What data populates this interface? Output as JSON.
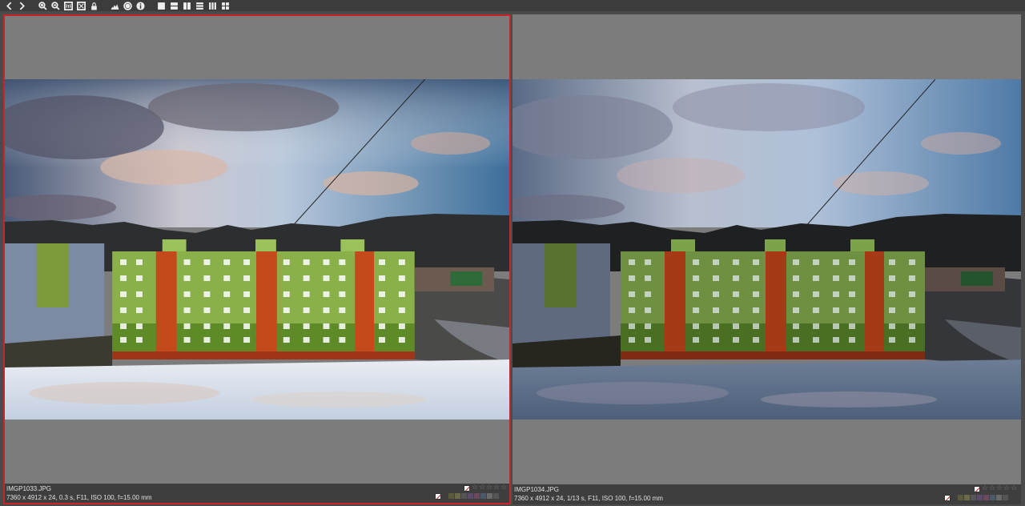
{
  "toolbar": {
    "items": [
      {
        "name": "prev-icon",
        "glyph": "‹"
      },
      {
        "name": "next-icon",
        "glyph": "›"
      }
    ]
  },
  "left_pane": {
    "filename": "IMGP1033.JPG",
    "meta": "7360 x 4912 x 24, 0.3 s, F11, ISO 100, f=15.00 mm",
    "rating_stars": 5,
    "selected": true
  },
  "right_pane": {
    "filename": "IMGP1034.JPG",
    "meta": "7360 x 4912 x 24, 1/13 s, F11, ISO 100, f=15.00 mm",
    "rating_stars": 5,
    "selected": false
  },
  "color_labels": [
    "#5b5b3c",
    "#6a6a48",
    "#565656",
    "#5c4a6a",
    "#6a4a5c",
    "#4a5a6a",
    "#6a6a6a",
    "#4a4a4a"
  ],
  "accent_color": "#c8242a"
}
